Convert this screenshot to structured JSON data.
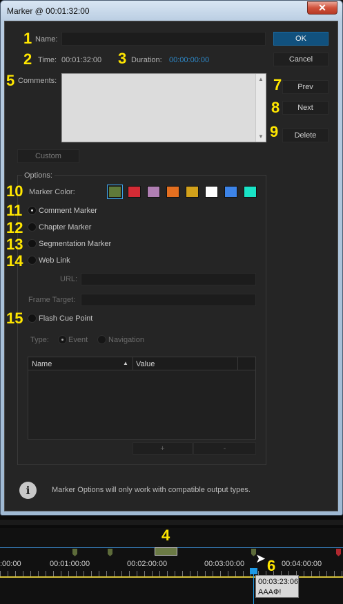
{
  "window": {
    "title": "Marker @ 00:01:32:00",
    "close_glyph": "✕"
  },
  "labels": {
    "name": "Name:",
    "time": "Time:",
    "time_value": "00:01:32:00",
    "duration": "Duration:",
    "duration_value": "00:00:00:00",
    "comments": "Comments:"
  },
  "fields": {
    "name_value": "",
    "comments_value": ""
  },
  "buttons": {
    "ok": "OK",
    "cancel": "Cancel",
    "prev": "Prev",
    "next": "Next",
    "delete": "Delete",
    "custom": "Custom",
    "add": "+",
    "remove": "-"
  },
  "options": {
    "legend": "Options:",
    "marker_color": "Marker Color:",
    "colors": [
      "#5f7a3a",
      "#d42b35",
      "#b07fb3",
      "#e36f20",
      "#d2a11b",
      "#ffffff",
      "#3d84e8",
      "#19e3c6"
    ],
    "selected_color_index": 0,
    "marker_types": [
      "Comment Marker",
      "Chapter Marker",
      "Segmentation Marker",
      "Web Link",
      "Flash Cue Point"
    ],
    "selected_type_index": 0,
    "url_label": "URL:",
    "url_value": "",
    "frame_target_label": "Frame Target:",
    "frame_target_value": "",
    "type_label": "Type:",
    "type_event": "Event",
    "type_navigation": "Navigation",
    "table_headers": [
      "Name",
      "Value"
    ],
    "sort_glyph": "▲"
  },
  "info": {
    "icon": "i",
    "text": "Marker Options will only work with compatible output types."
  },
  "annotations": [
    "1",
    "2",
    "3",
    "4",
    "5",
    "6",
    "7",
    "8",
    "9",
    "10",
    "11",
    "12",
    "13",
    "14",
    "15"
  ],
  "timeline": {
    "ticks": [
      ":00:00",
      "00:01:00:00",
      "00:02:00:00",
      "00:03:00:00",
      "00:04:00:00"
    ],
    "tooltip_time": "00:03:23:06",
    "tooltip_text": "AAAФ!",
    "accent": "#3a86c8",
    "playhead": "#1e9ae6"
  }
}
